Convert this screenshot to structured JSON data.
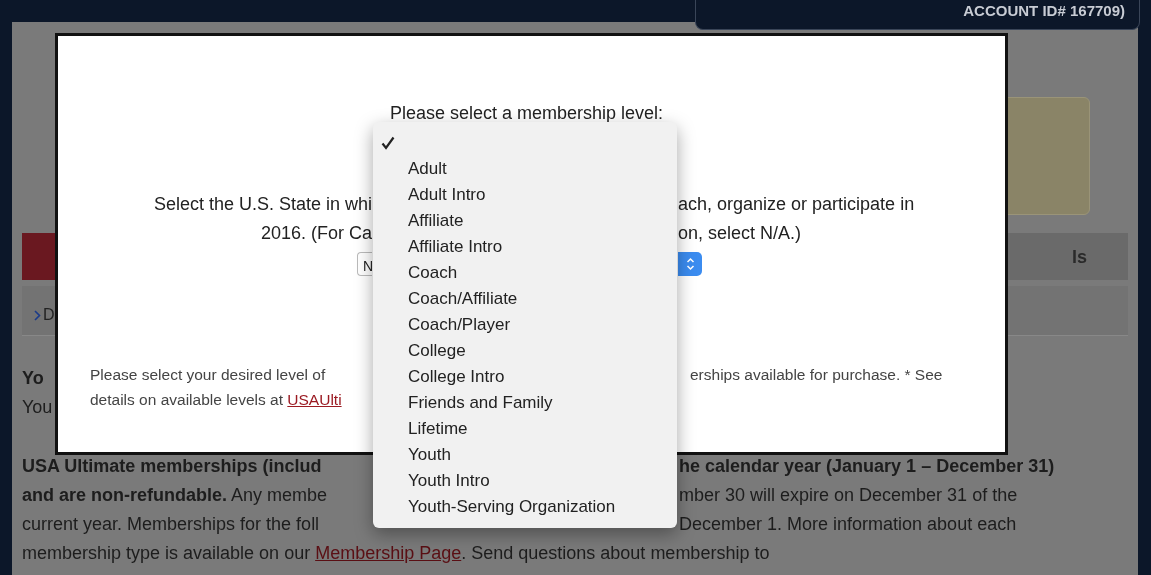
{
  "header": {
    "account_id": "ACCOUNT ID# 167709)"
  },
  "page": {
    "tab_fragment": "ls",
    "breadcrumb_fragment": "D",
    "text_fragments": [
      {
        "text": "Yo",
        "bold": true
      },
      {
        "text": "You",
        "bold": false
      }
    ],
    "notice_lines": [
      {
        "left": "USA Ultimate memberships (includ",
        "right": "he calendar year (January 1 – December 31)",
        "bold": true
      },
      {
        "left": "**and are non-refundable.** Any membe",
        "right": "mber 30 will expire on December 31 of the",
        "bold": false
      },
      {
        "left": "current year. Memberships for the foll",
        "right": "December 1. More information about each",
        "bold": false
      }
    ],
    "link_line": {
      "before": "membership type is available on our ",
      "link": "Membership Page",
      "after": ". Send questions about membership to"
    }
  },
  "modal": {
    "title": "Please select a membership level:",
    "state_prompt": [
      {
        "left": "Select the U.S. State in whi",
        "right": "ach, organize or participate in"
      },
      {
        "left": "2016. (For Ca",
        "right": "on, select N/A.)"
      }
    ],
    "state_select": {
      "value_fragment": "N"
    },
    "footnote": [
      {
        "left": "Please select your desired level of",
        "right": "erships available for purchase. * See"
      },
      {
        "left": "details on available levels at ",
        "link": "USAUlti"
      }
    ]
  },
  "dropdown": {
    "options": [
      {
        "selected": true
      },
      {
        "label": "Adult",
        "selected": false
      },
      {
        "label": "Adult Intro",
        "selected": false
      },
      {
        "label": "Affiliate",
        "selected": false
      },
      {
        "label": "Affiliate Intro",
        "selected": false
      },
      {
        "label": "Coach",
        "selected": false
      },
      {
        "label": "Coach/Affiliate",
        "selected": false
      },
      {
        "label": "Coach/Player",
        "selected": false
      },
      {
        "label": "College",
        "selected": false
      },
      {
        "label": "College Intro",
        "selected": false
      },
      {
        "label": "Friends and Family",
        "selected": false
      },
      {
        "label": "Lifetime",
        "selected": false
      },
      {
        "label": "Youth",
        "selected": false
      },
      {
        "label": "Youth Intro",
        "selected": false
      },
      {
        "label": "Youth-Serving Organization",
        "selected": false
      }
    ]
  }
}
